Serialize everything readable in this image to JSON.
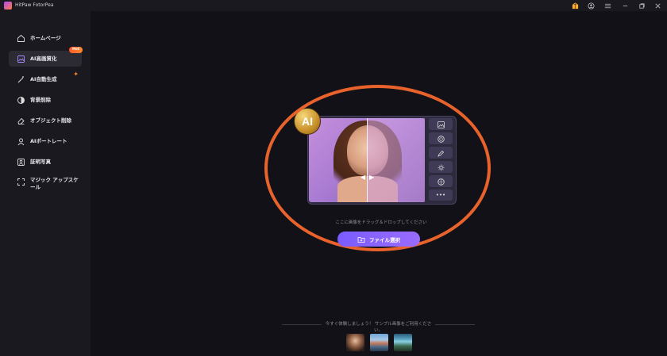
{
  "app": {
    "title": "HitPaw FotorPea"
  },
  "sidebar": {
    "items": [
      {
        "label": "ホームページ",
        "icon": "home-icon"
      },
      {
        "label": "AI高画質化",
        "icon": "image-enhance-icon",
        "badge": "Hot",
        "active": true
      },
      {
        "label": "AI自動生成",
        "icon": "magic-wand-icon"
      },
      {
        "label": "背景削除",
        "icon": "background-remove-icon"
      },
      {
        "label": "オブジェクト削除",
        "icon": "eraser-icon"
      },
      {
        "label": "AIポートレート",
        "icon": "portrait-icon"
      },
      {
        "label": "証明写真",
        "icon": "id-photo-icon"
      },
      {
        "label": "マジック アップスケール",
        "icon": "upscale-icon"
      }
    ]
  },
  "main": {
    "ai_badge": "AI",
    "drop_hint": "ここに画像をドラッグ＆ドロップしてください",
    "file_button": "ファイル選択",
    "sample_hint": "今すぐ体験しましょう！ サンプル画像をご利用ください。"
  },
  "colors": {
    "accent": "#8a63ff",
    "highlight": "#e8622c",
    "hot": "#ff5a2c"
  }
}
